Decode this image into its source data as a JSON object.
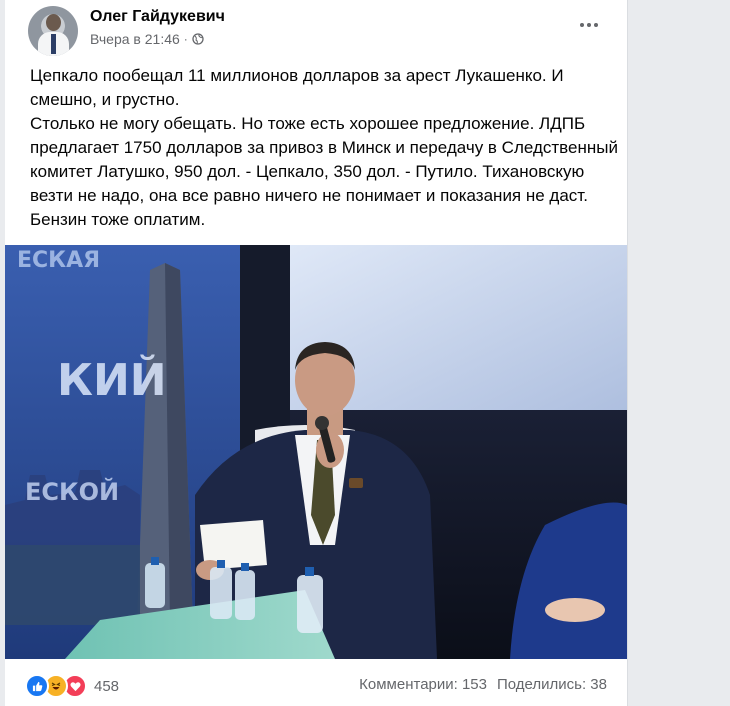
{
  "post": {
    "author": "Олег Гайдукевич",
    "timestamp": "Вчера в 21:46",
    "separator": "·",
    "privacy_icon": "globe-icon",
    "menu_icon": "more-options-icon",
    "text_lines": [
      "Цепкало пообещал 11 миллионов долларов за арест Лукашенко. И смешно, и грустно.",
      "Столько не могу обещать. Но тоже есть хорошее предложение. ЛДПБ предлагает  1750 долларов за привоз в Минск и передачу  в Следственный комитет Латушко, 950 дол. - Цепкало, 350 дол. - Путило. Тихановскую   везти не надо, она все равно ничего не понимает и показания не даст. Бензин  тоже оплатим."
    ]
  },
  "photo": {
    "banner_texts": [
      "ЕСКАЯ",
      "КИЙ",
      "ЕСКОЙ"
    ]
  },
  "footer": {
    "reaction_icons": [
      "like-icon",
      "haha-icon",
      "love-icon"
    ],
    "reaction_count": "458",
    "comments": "Комментарии: 153",
    "shares": "Поделились: 38"
  },
  "colors": {
    "like": "#1877f2",
    "haha": "#f7b125",
    "love": "#f33e58",
    "secondary_text": "#65676b"
  }
}
